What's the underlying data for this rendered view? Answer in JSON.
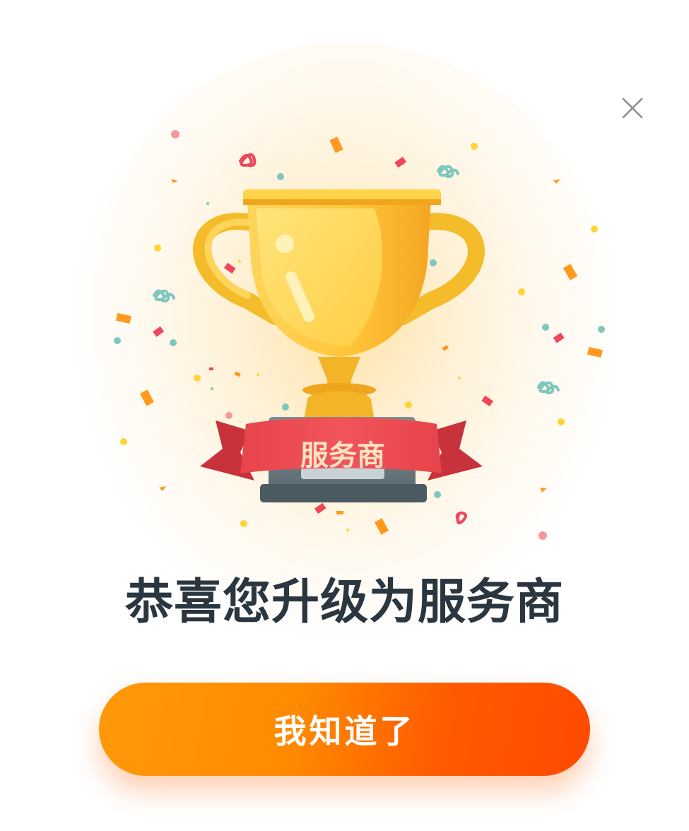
{
  "dialog": {
    "badge_text": "服务商",
    "headline": "恭喜您升级为服务商",
    "confirm_label": "我知道了",
    "close_icon": "close-icon",
    "trophy_icon": "trophy-illustration"
  },
  "colors": {
    "cta_start": "#ff9a0a",
    "cta_end": "#ff4a00",
    "headline": "#2a3640",
    "ribbon": "#e8434b",
    "trophy_gold": "#ffc63a"
  }
}
